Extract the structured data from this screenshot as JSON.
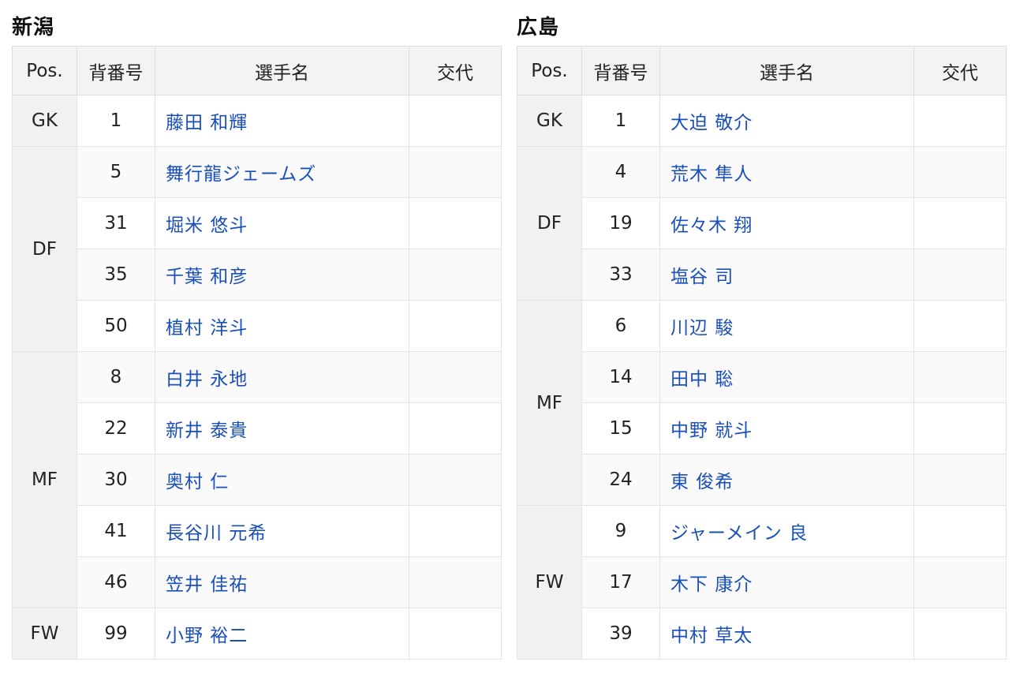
{
  "headers": {
    "pos": "Pos.",
    "number": "背番号",
    "player": "選手名",
    "substitution": "交代"
  },
  "teams": [
    {
      "name": "新潟",
      "rows": [
        {
          "pos": "GK",
          "number": "1",
          "player": "藤田 和輝",
          "substitution": ""
        },
        {
          "pos": "DF",
          "number": "5",
          "player": "舞行龍ジェームズ",
          "substitution": ""
        },
        {
          "pos": "",
          "number": "31",
          "player": "堀米 悠斗",
          "substitution": ""
        },
        {
          "pos": "",
          "number": "35",
          "player": "千葉 和彦",
          "substitution": ""
        },
        {
          "pos": "",
          "number": "50",
          "player": "植村 洋斗",
          "substitution": ""
        },
        {
          "pos": "MF",
          "number": "8",
          "player": "白井 永地",
          "substitution": ""
        },
        {
          "pos": "",
          "number": "22",
          "player": "新井 泰貴",
          "substitution": ""
        },
        {
          "pos": "",
          "number": "30",
          "player": "奥村 仁",
          "substitution": ""
        },
        {
          "pos": "",
          "number": "41",
          "player": "長谷川 元希",
          "substitution": ""
        },
        {
          "pos": "",
          "number": "46",
          "player": "笠井 佳祐",
          "substitution": ""
        },
        {
          "pos": "FW",
          "number": "99",
          "player": "小野 裕二",
          "substitution": ""
        }
      ]
    },
    {
      "name": "広島",
      "rows": [
        {
          "pos": "GK",
          "number": "1",
          "player": "大迫 敬介",
          "substitution": ""
        },
        {
          "pos": "DF",
          "number": "4",
          "player": "荒木 隼人",
          "substitution": ""
        },
        {
          "pos": "",
          "number": "19",
          "player": "佐々木 翔",
          "substitution": ""
        },
        {
          "pos": "",
          "number": "33",
          "player": "塩谷 司",
          "substitution": ""
        },
        {
          "pos": "MF",
          "number": "6",
          "player": "川辺 駿",
          "substitution": ""
        },
        {
          "pos": "",
          "number": "14",
          "player": "田中 聡",
          "substitution": ""
        },
        {
          "pos": "",
          "number": "15",
          "player": "中野 就斗",
          "substitution": ""
        },
        {
          "pos": "",
          "number": "24",
          "player": "東 俊希",
          "substitution": ""
        },
        {
          "pos": "FW",
          "number": "9",
          "player": "ジャーメイン 良",
          "substitution": ""
        },
        {
          "pos": "",
          "number": "17",
          "player": "木下 康介",
          "substitution": ""
        },
        {
          "pos": "",
          "number": "39",
          "player": "中村 草太",
          "substitution": ""
        }
      ]
    }
  ]
}
